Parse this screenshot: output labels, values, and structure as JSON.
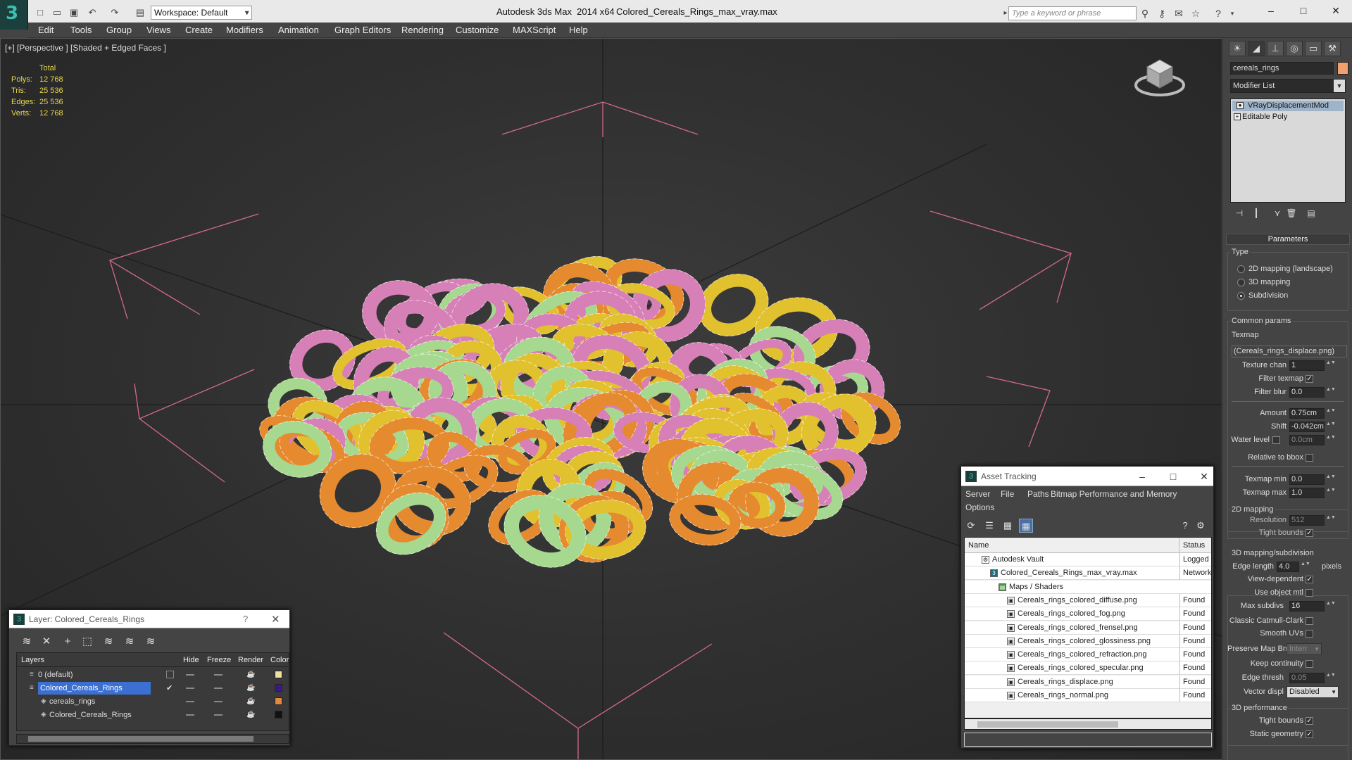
{
  "titlebar": {
    "logo_glyph": "3",
    "workspace": "Workspace: Default",
    "app_name": "Autodesk 3ds Max  2014 x64",
    "file_name": "Colored_Cereals_Rings_max_vray.max",
    "search_placeholder": "Type a keyword or phrase"
  },
  "menubar": [
    "Edit",
    "Tools",
    "Group",
    "Views",
    "Create",
    "Modifiers",
    "Animation",
    "Graph Editors",
    "Rendering",
    "Customize",
    "MAXScript",
    "Help"
  ],
  "viewport": {
    "label": "[+] [Perspective ] [Shaded + Edged Faces ]",
    "stats": {
      "header": "Total",
      "rows": [
        {
          "label": "Polys:",
          "value": "12 768"
        },
        {
          "label": "Tris:",
          "value": "25 536"
        },
        {
          "label": "Edges:",
          "value": "25 536"
        },
        {
          "label": "Verts:",
          "value": "12 768"
        }
      ]
    },
    "ring_colors": [
      "#d77fb7",
      "#e2c12e",
      "#e58a2f",
      "#a6d98f"
    ]
  },
  "command_panel": {
    "object_name": "cereals_rings",
    "object_color": "#f2a070",
    "modifier_list": "Modifier List",
    "stack": [
      "VRayDisplacementMod",
      "Editable Poly"
    ],
    "rollout_title": "Parameters",
    "type_group": "Type",
    "type_options": [
      {
        "label": "2D mapping (landscape)",
        "selected": false
      },
      {
        "label": "3D mapping",
        "selected": false
      },
      {
        "label": "Subdivision",
        "selected": true
      }
    ],
    "common_group": "Common params",
    "texmap_label": "Texmap",
    "texmap_value": "(Cereals_rings_displace.png)",
    "texture_chan": {
      "label": "Texture chan",
      "value": "1"
    },
    "filter_texmap": {
      "label": "Filter texmap",
      "checked": true
    },
    "filter_blur": {
      "label": "Filter blur",
      "value": "0.0"
    },
    "amount": {
      "label": "Amount",
      "value": "0.75cm"
    },
    "shift": {
      "label": "Shift",
      "value": "-0.042cm"
    },
    "water_level": {
      "label": "Water level",
      "value": "0.0cm",
      "checked": false
    },
    "relative_bbox": {
      "label": "Relative to bbox",
      "checked": false
    },
    "texmap_min": {
      "label": "Texmap min",
      "value": "0.0"
    },
    "texmap_max": {
      "label": "Texmap max",
      "value": "1.0"
    },
    "mapping2d_group": "2D mapping",
    "resolution": {
      "label": "Resolution",
      "value": "512"
    },
    "tight_bounds_2d": {
      "label": "Tight bounds",
      "checked": true
    },
    "mapping3d_group": "3D mapping/subdivision",
    "edge_length": {
      "label": "Edge length",
      "value": "4.0",
      "unit": "pixels"
    },
    "view_dependent": {
      "label": "View-dependent",
      "checked": true
    },
    "use_object_mtl": {
      "label": "Use object mtl",
      "checked": false
    },
    "max_subdivs": {
      "label": "Max subdivs",
      "value": "16"
    },
    "classic_catmull": {
      "label": "Classic Catmull-Clark",
      "checked": false
    },
    "smooth_uvs": {
      "label": "Smooth UVs",
      "checked": false
    },
    "preserve_map_bnd": {
      "label": "Preserve Map Bnd",
      "value": "Interr"
    },
    "keep_continuity": {
      "label": "Keep continuity",
      "checked": false
    },
    "edge_thresh": {
      "label": "Edge thresh",
      "value": "0.05"
    },
    "vector_displ": {
      "label": "Vector displ",
      "value": "Disabled"
    },
    "perf_group": "3D performance",
    "tight_bounds_3d": {
      "label": "Tight bounds",
      "checked": true
    },
    "static_geometry": {
      "label": "Static geometry",
      "checked": true
    }
  },
  "layer_dialog": {
    "title": "Layer: Colored_Cereals_Rings",
    "help": "?",
    "columns": [
      "Layers",
      "Hide",
      "Freeze",
      "Render",
      "Color"
    ],
    "rows": [
      {
        "name": "0 (default)",
        "indent": 1,
        "color": "#f0e0a0",
        "checkbox": true,
        "selected": false
      },
      {
        "name": "Colored_Cereals_Rings",
        "indent": 1,
        "color": "#3a1a8a",
        "checkbox": false,
        "checkmark": "✔",
        "selected": true
      },
      {
        "name": "cereals_rings",
        "indent": 2,
        "color": "#e58a3a",
        "checkbox": false,
        "selected": false
      },
      {
        "name": "Colored_Cereals_Rings",
        "indent": 2,
        "color": "#111111",
        "checkbox": false,
        "selected": false
      }
    ]
  },
  "asset_dialog": {
    "title": "Asset Tracking",
    "menu": [
      "Server",
      "File",
      "Paths",
      "Bitmap Performance and Memory",
      "Options"
    ],
    "columns": [
      "Name",
      "Status"
    ],
    "rows": [
      {
        "name": "Autodesk Vault",
        "indent": 1,
        "status": "Logged Out"
      },
      {
        "name": "Colored_Cereals_Rings_max_vray.max",
        "indent": 2,
        "status": "Network"
      },
      {
        "name": "Maps / Shaders",
        "indent": 3,
        "status": ""
      },
      {
        "name": "Cereals_rings_colored_diffuse.png",
        "indent": 4,
        "status": "Found"
      },
      {
        "name": "Cereals_rings_colored_fog.png",
        "indent": 4,
        "status": "Found"
      },
      {
        "name": "Cereals_rings_colored_frensel.png",
        "indent": 4,
        "status": "Found"
      },
      {
        "name": "Cereals_rings_colored_glossiness.png",
        "indent": 4,
        "status": "Found"
      },
      {
        "name": "Cereals_rings_colored_refraction.png",
        "indent": 4,
        "status": "Found"
      },
      {
        "name": "Cereals_rings_colored_specular.png",
        "indent": 4,
        "status": "Found"
      },
      {
        "name": "Cereals_rings_displace.png",
        "indent": 4,
        "status": "Found"
      },
      {
        "name": "Cereals_rings_normal.png",
        "indent": 4,
        "status": "Found"
      }
    ]
  }
}
